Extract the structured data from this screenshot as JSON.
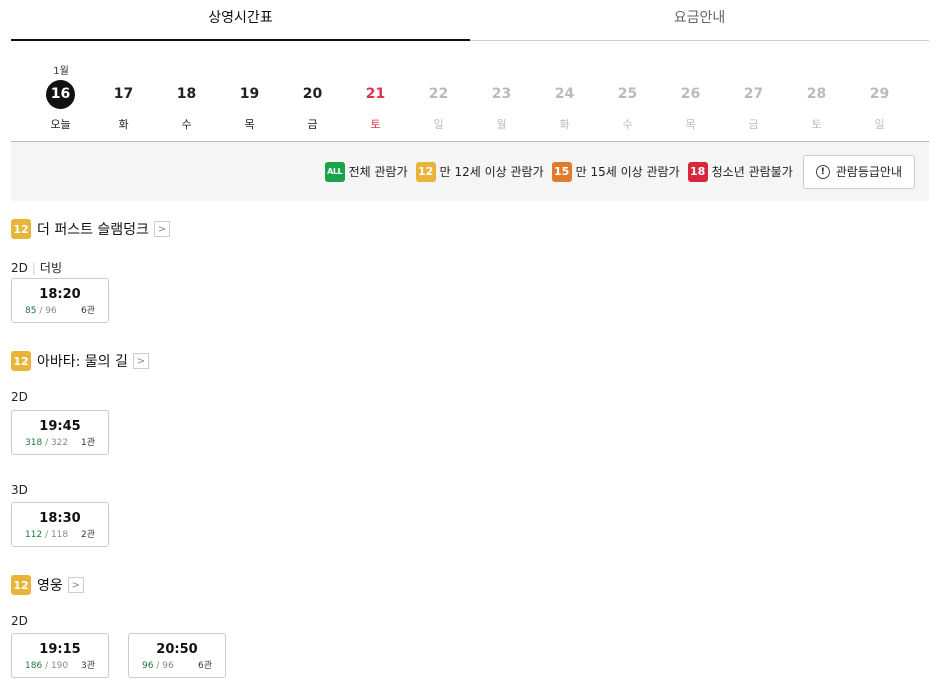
{
  "tabs": [
    {
      "label": "상영시간표",
      "active": true
    },
    {
      "label": "요금안내",
      "active": false
    }
  ],
  "month_label": "1월",
  "dates": [
    {
      "day": "16",
      "dow": "오늘",
      "state": "today"
    },
    {
      "day": "17",
      "dow": "화",
      "state": "normal"
    },
    {
      "day": "18",
      "dow": "수",
      "state": "normal"
    },
    {
      "day": "19",
      "dow": "목",
      "state": "normal"
    },
    {
      "day": "20",
      "dow": "금",
      "state": "normal"
    },
    {
      "day": "21",
      "dow": "토",
      "state": "sat"
    },
    {
      "day": "22",
      "dow": "일",
      "state": "disabled"
    },
    {
      "day": "23",
      "dow": "월",
      "state": "disabled"
    },
    {
      "day": "24",
      "dow": "화",
      "state": "disabled"
    },
    {
      "day": "25",
      "dow": "수",
      "state": "disabled"
    },
    {
      "day": "26",
      "dow": "목",
      "state": "disabled"
    },
    {
      "day": "27",
      "dow": "금",
      "state": "disabled"
    },
    {
      "day": "28",
      "dow": "토",
      "state": "disabled"
    },
    {
      "day": "29",
      "dow": "일",
      "state": "disabled"
    }
  ],
  "ratings": {
    "all": {
      "badge": "ALL",
      "label": "전체 관람가"
    },
    "r12": {
      "badge": "12",
      "label": "만 12세 이상 관람가"
    },
    "r15": {
      "badge": "15",
      "label": "만 15세 이상 관람가"
    },
    "r18": {
      "badge": "18",
      "label": "청소년 관람불가"
    },
    "guide_button": "관람등급안내"
  },
  "colors": {
    "rating_all": "#1aa34a",
    "rating_12": "#e8b53a",
    "rating_15": "#e07a2f",
    "rating_18": "#d6283d",
    "saturday": "#e0344e",
    "seats_available": "#1f7a3a"
  },
  "movies": [
    {
      "rating": "12",
      "title": "더 퍼스트 슬램덩크",
      "chevron": ">",
      "formats": [
        {
          "format": "2D",
          "sub": "더빙",
          "shows": [
            {
              "time": "18:20",
              "available": "85",
              "total": "/ 96",
              "hall": "6관"
            }
          ]
        }
      ]
    },
    {
      "rating": "12",
      "title": "아바타: 물의 길",
      "chevron": ">",
      "formats": [
        {
          "format": "2D",
          "shows": [
            {
              "time": "19:45",
              "available": "318",
              "total": "/ 322",
              "hall": "1관"
            }
          ]
        },
        {
          "format": "3D",
          "shows": [
            {
              "time": "18:30",
              "available": "112",
              "total": "/ 118",
              "hall": "2관"
            }
          ]
        }
      ]
    },
    {
      "rating": "12",
      "title": "영웅",
      "chevron": ">",
      "formats": [
        {
          "format": "2D",
          "shows": [
            {
              "time": "19:15",
              "available": "186",
              "total": "/ 190",
              "hall": "3관"
            },
            {
              "time": "20:50",
              "available": "96",
              "total": "/ 96",
              "hall": "6관"
            }
          ]
        }
      ]
    }
  ]
}
